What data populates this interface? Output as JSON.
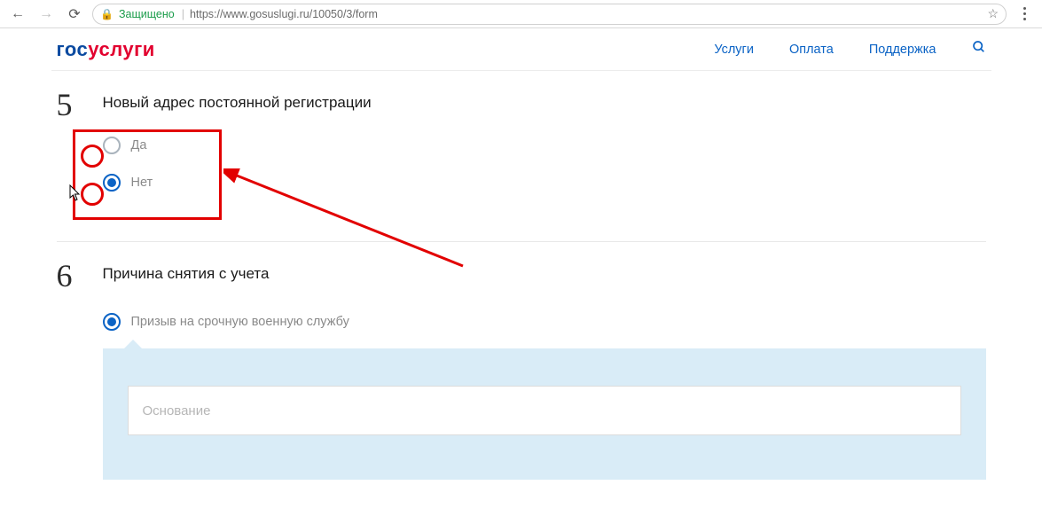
{
  "browser": {
    "secure_label": "Защищено",
    "url": "https://www.gosuslugi.ru/10050/3/form"
  },
  "logo": {
    "part1": "гос",
    "part2": "услуги"
  },
  "nav": {
    "services": "Услуги",
    "payment": "Оплата",
    "support": "Поддержка"
  },
  "step5": {
    "number": "5",
    "title": "Новый адрес постоянной регистрации",
    "option_yes": "Да",
    "option_no": "Нет"
  },
  "step6": {
    "number": "6",
    "title": "Причина снятия с учета",
    "option_conscription": "Призыв на срочную военную службу",
    "reason_placeholder": "Основание"
  }
}
